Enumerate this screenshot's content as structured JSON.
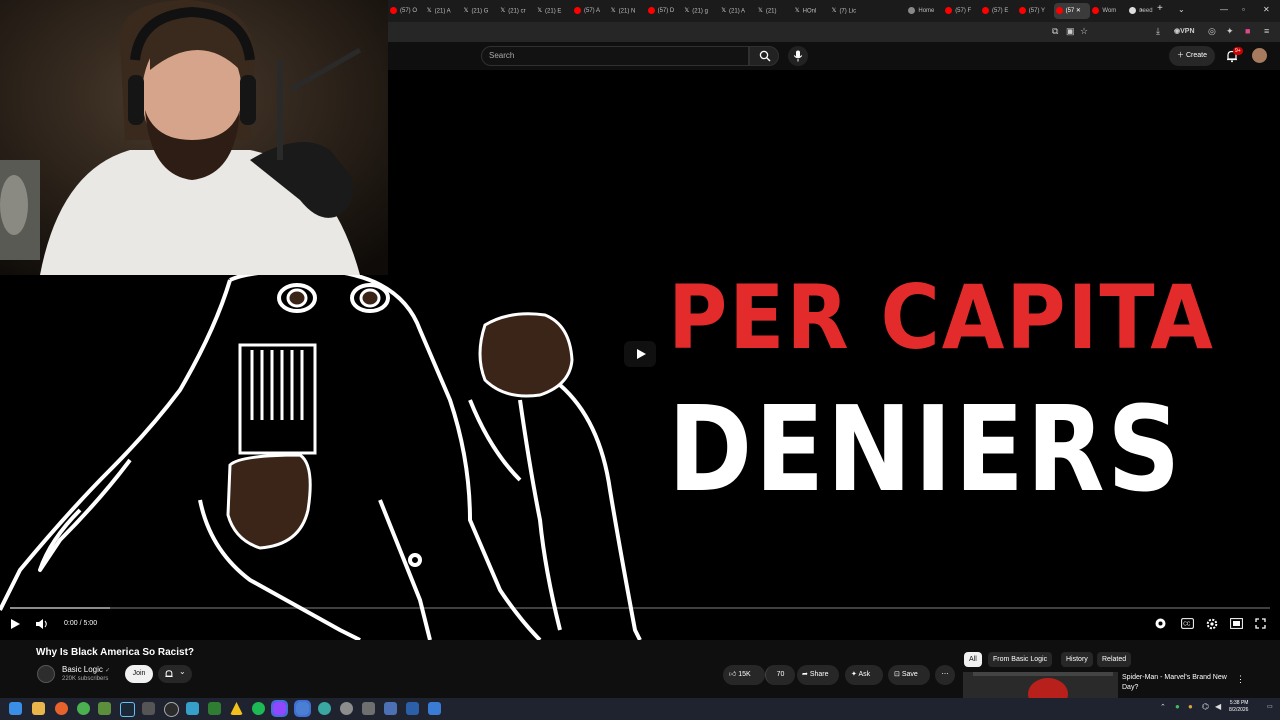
{
  "browser": {
    "tabs": [
      {
        "label": "(57) O",
        "icon": "youtube-icon"
      },
      {
        "label": "(21) A",
        "icon": "x-icon"
      },
      {
        "label": "(21) G",
        "icon": "x-icon"
      },
      {
        "label": "(21) cr",
        "icon": "x-icon"
      },
      {
        "label": "(21) E",
        "icon": "x-icon"
      },
      {
        "label": "(57) A",
        "icon": "youtube-icon"
      },
      {
        "label": "(21) N",
        "icon": "x-icon"
      },
      {
        "label": "(57) D",
        "icon": "youtube-icon"
      },
      {
        "label": "(21) g",
        "icon": "x-icon"
      },
      {
        "label": "(21) A",
        "icon": "x-icon"
      },
      {
        "label": "(21)",
        "icon": "x-icon"
      },
      {
        "label": "HOnl",
        "icon": "x-icon"
      },
      {
        "label": "(7) Lic",
        "icon": "x-icon"
      },
      {
        "label": "Home",
        "icon": "globe-icon"
      },
      {
        "label": "(57) F",
        "icon": "youtube-icon"
      },
      {
        "label": "(57) E",
        "icon": "youtube-icon"
      },
      {
        "label": "(57) Y",
        "icon": "youtube-icon"
      },
      {
        "label": "(57",
        "icon": "youtube-icon",
        "active": true
      },
      {
        "label": "Wom",
        "icon": "youtube-icon"
      },
      {
        "label": "need",
        "icon": "chatgpt-icon"
      }
    ],
    "toolbar": {
      "vpn_label": "VPN",
      "ext_badge": "5"
    }
  },
  "youtube": {
    "search": {
      "placeholder": "Search"
    },
    "create_label": "Create",
    "notification_count": "9+"
  },
  "video": {
    "thumbnail_line1": "PER CAPITA",
    "thumbnail_line2": "DENIERS",
    "time": "0:00 / 5:00",
    "progress_fraction": 0.0,
    "title": "Why Is Black America So Racist?",
    "channel": {
      "name": "Basic Logic",
      "verified_mark": "✓",
      "subscribers": "220K subscribers"
    },
    "join_label": "Join",
    "likes": "15K",
    "dislikes": "70",
    "share_label": "Share",
    "ask_label": "Ask",
    "save_label": "Save"
  },
  "sidebar": {
    "chips": [
      {
        "label": "All",
        "selected": true
      },
      {
        "label": "From Basic Logic",
        "selected": false
      },
      {
        "label": "History",
        "selected": false
      },
      {
        "label": "Related",
        "selected": false
      }
    ],
    "related_title": "Spider-Man - Marvel's Brand New Day?"
  },
  "taskbar": {
    "time": "5:38 PM",
    "date": "8/2/2026"
  },
  "colors": {
    "youtube_red": "#ff0000",
    "thumbnail_red": "#e32b2b",
    "background": "#0f0f0f"
  }
}
